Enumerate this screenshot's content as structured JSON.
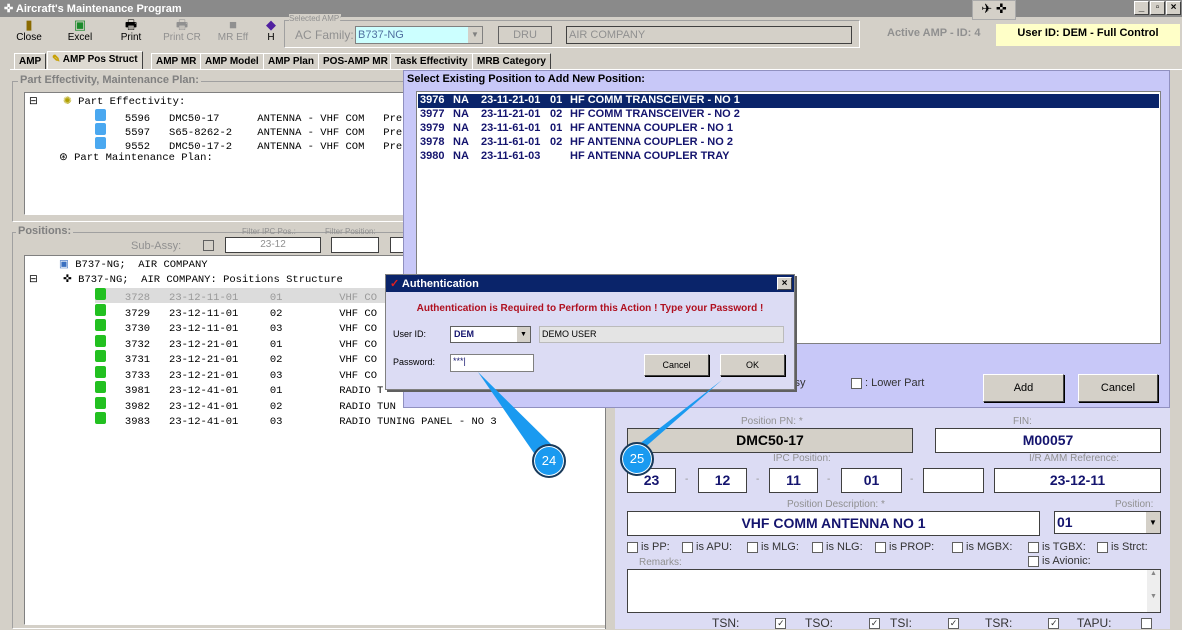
{
  "window": {
    "title": "Aircraft's Maintenance Program"
  },
  "toolbar": {
    "buttons": [
      {
        "label": "Close",
        "icon": "door-icon"
      },
      {
        "label": "Excel",
        "icon": "excel-icon"
      },
      {
        "label": "Print",
        "icon": "printer-icon"
      },
      {
        "label": "Print CR",
        "icon": "printer-icon"
      },
      {
        "label": "MR Eff",
        "icon": "square-icon"
      },
      {
        "label": "H",
        "icon": "help-icon"
      }
    ]
  },
  "selected_amp": {
    "group_label": "Selected AMP:",
    "ac_family_label": "AC Family:",
    "ac_family_value": "B737-NG",
    "operator_code": "DRU",
    "operator_name": "AIR COMPANY"
  },
  "status": {
    "active_amp": "Active AMP - ID: 4",
    "user": "User ID: DEM - Full Control"
  },
  "tabs": [
    "AMP",
    "AMP Pos Struct",
    "AMP MR",
    "AMP Model",
    "AMP Plan",
    "POS-AMP MR",
    "Task Effectivity",
    "MRB Category"
  ],
  "part_eff": {
    "group_label": "Part Effectivity, Maintenance Plan:",
    "root": "Part Effectivity:",
    "items": [
      [
        "5596",
        "DMC50-17",
        "ANTENNA - VHF COM",
        "Prefera"
      ],
      [
        "5597",
        "S65-8262-2",
        "ANTENNA - VHF COM",
        "Prefera"
      ],
      [
        "9552",
        "DMC50-17-2",
        "ANTENNA - VHF COM",
        "Prefera"
      ]
    ],
    "plan": "Part Maintenance Plan:"
  },
  "positions": {
    "group_label": "Positions:",
    "filter_ipc_label": "Filter IPC Pos.:",
    "filter_position_label": "Filter Position:",
    "sub_assy_label": "Sub-Assy:",
    "filter_ipc_value": "23-12",
    "root1": "B737-NG;  AIR COMPANY",
    "root2": "B737-NG;  AIR COMPANY: Positions Structure",
    "rows": [
      [
        "3728",
        "23-12-11-01",
        "01",
        "VHF CO"
      ],
      [
        "3729",
        "23-12-11-01",
        "02",
        "VHF CO"
      ],
      [
        "3730",
        "23-12-11-01",
        "03",
        "VHF CO"
      ],
      [
        "3732",
        "23-12-21-01",
        "01",
        "VHF CO"
      ],
      [
        "3731",
        "23-12-21-01",
        "02",
        "VHF CO"
      ],
      [
        "3733",
        "23-12-21-01",
        "03",
        "VHF CO"
      ],
      [
        "3981",
        "23-12-41-01",
        "01",
        "RADIO T"
      ],
      [
        "3982",
        "23-12-41-01",
        "02",
        "RADIO TUN"
      ],
      [
        "3983",
        "23-12-41-01",
        "03",
        "RADIO TUNING PANEL - NO 3"
      ]
    ]
  },
  "select_existing": {
    "title": "Select Existing Position to Add New Position:",
    "rows": [
      [
        "3976",
        "NA",
        "23-11-21-01",
        "01",
        "HF COMM TRANSCEIVER - NO 1"
      ],
      [
        "3977",
        "NA",
        "23-11-21-01",
        "02",
        "HF COMM TRANSCEIVER - NO 2"
      ],
      [
        "3979",
        "NA",
        "23-11-61-01",
        "01",
        "HF ANTENNA COUPLER - NO 1"
      ],
      [
        "3978",
        "NA",
        "23-11-61-01",
        "02",
        "HF ANTENNA COUPLER - NO 2"
      ],
      [
        "3980",
        "NA",
        "23-11-61-03",
        "",
        "HF ANTENNA COUPLER TRAY"
      ]
    ],
    "sub_assy_partial": "ssy",
    "lower_part": ": Lower Part",
    "add": "Add",
    "cancel": "Cancel"
  },
  "form": {
    "pn_label": "Position PN:",
    "pn": "DMC50-17",
    "fin_label": "FIN:",
    "fin": "M00057",
    "ipc_label": "IPC Position:",
    "ipc": [
      "23",
      "12",
      "11",
      "01",
      ""
    ],
    "amm_label": "I/R AMM Reference:",
    "amm": "23-12-11",
    "desc_label": "Position Description:",
    "desc": "VHF COMM ANTENNA NO 1",
    "position_label": "Position:",
    "position": "01",
    "star": "*",
    "dash": "-",
    "checks": [
      "is PP:",
      "is APU:",
      "is MLG:",
      "is NLG:",
      "is PROP:",
      "is MGBX:",
      "is TGBX:",
      "is Strct:",
      "is Avionic:"
    ],
    "remarks_label": "Remarks:",
    "bottom": [
      "TSN:",
      "TSO:",
      "TSI:",
      "TSR:",
      "TAPU:"
    ]
  },
  "auth": {
    "title": "Authentication",
    "message": "Authentication is Required to Perform this Action ! Type your Password !",
    "user_label": "User ID:",
    "user_value": "DEM",
    "user_name": "DEMO USER",
    "password_label": "Password:",
    "password_value": "***",
    "cancel": "Cancel",
    "ok": "OK"
  },
  "callouts": [
    "24",
    "25"
  ]
}
